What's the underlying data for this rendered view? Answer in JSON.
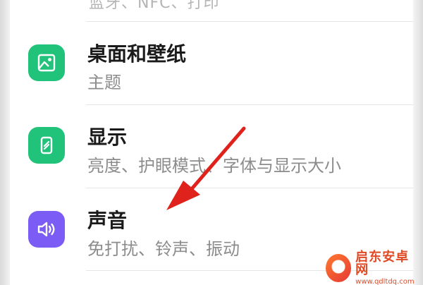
{
  "top_partial_text": "蓝牙、NFC、打印",
  "settings": [
    {
      "title": "桌面和壁纸",
      "subtitle": "主题",
      "icon": "wallpaper-icon",
      "color": "#21c27a"
    },
    {
      "title": "显示",
      "subtitle": "亮度、护眼模式、字体与显示大小",
      "icon": "display-icon",
      "color": "#21c27a"
    },
    {
      "title": "声音",
      "subtitle": "免打扰、铃声、振动",
      "icon": "speaker-icon",
      "color": "#7b5cf5"
    }
  ],
  "annotation": {
    "type": "arrow",
    "color": "#e0221c",
    "points_to": "声音"
  },
  "watermark": {
    "name": "启东安卓网",
    "url": "www.qdltdq.com"
  }
}
